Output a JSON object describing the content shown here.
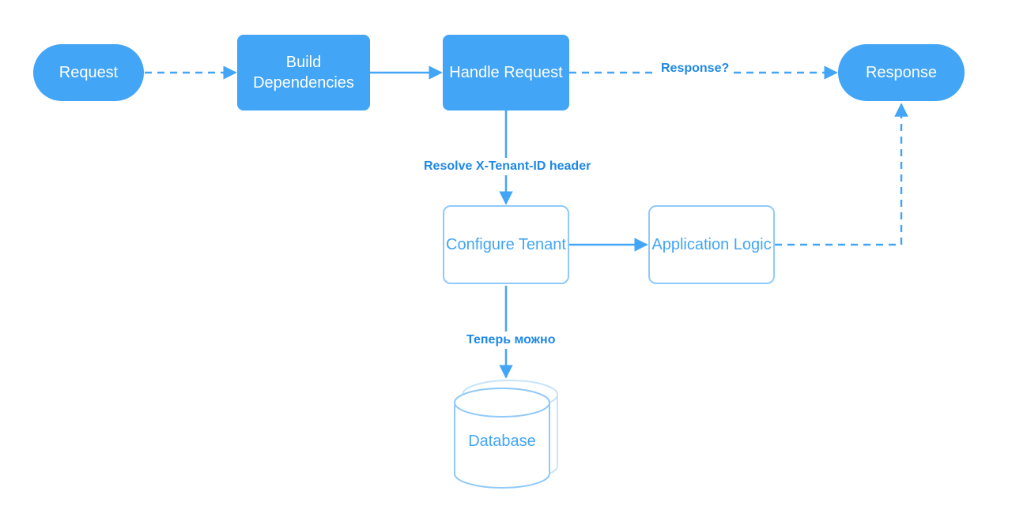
{
  "nodes": {
    "request": {
      "label": "Request"
    },
    "build_deps": {
      "label": "Build Dependencies"
    },
    "handle_req": {
      "label": "Handle Request"
    },
    "configure_tenant": {
      "label": "Configure Tenant"
    },
    "app_logic": {
      "label": "Application Logic"
    },
    "response": {
      "label": "Response"
    },
    "database": {
      "label": "Database"
    }
  },
  "edges": {
    "resolve_header": {
      "label": "Resolve X-Tenant-ID header"
    },
    "response_q": {
      "label": "Response?"
    },
    "now_allowed": {
      "label": "Теперь можно"
    }
  },
  "colors": {
    "primary": "#42a5f5",
    "primary_light": "#90caf9",
    "edge": "#1e88e5"
  }
}
